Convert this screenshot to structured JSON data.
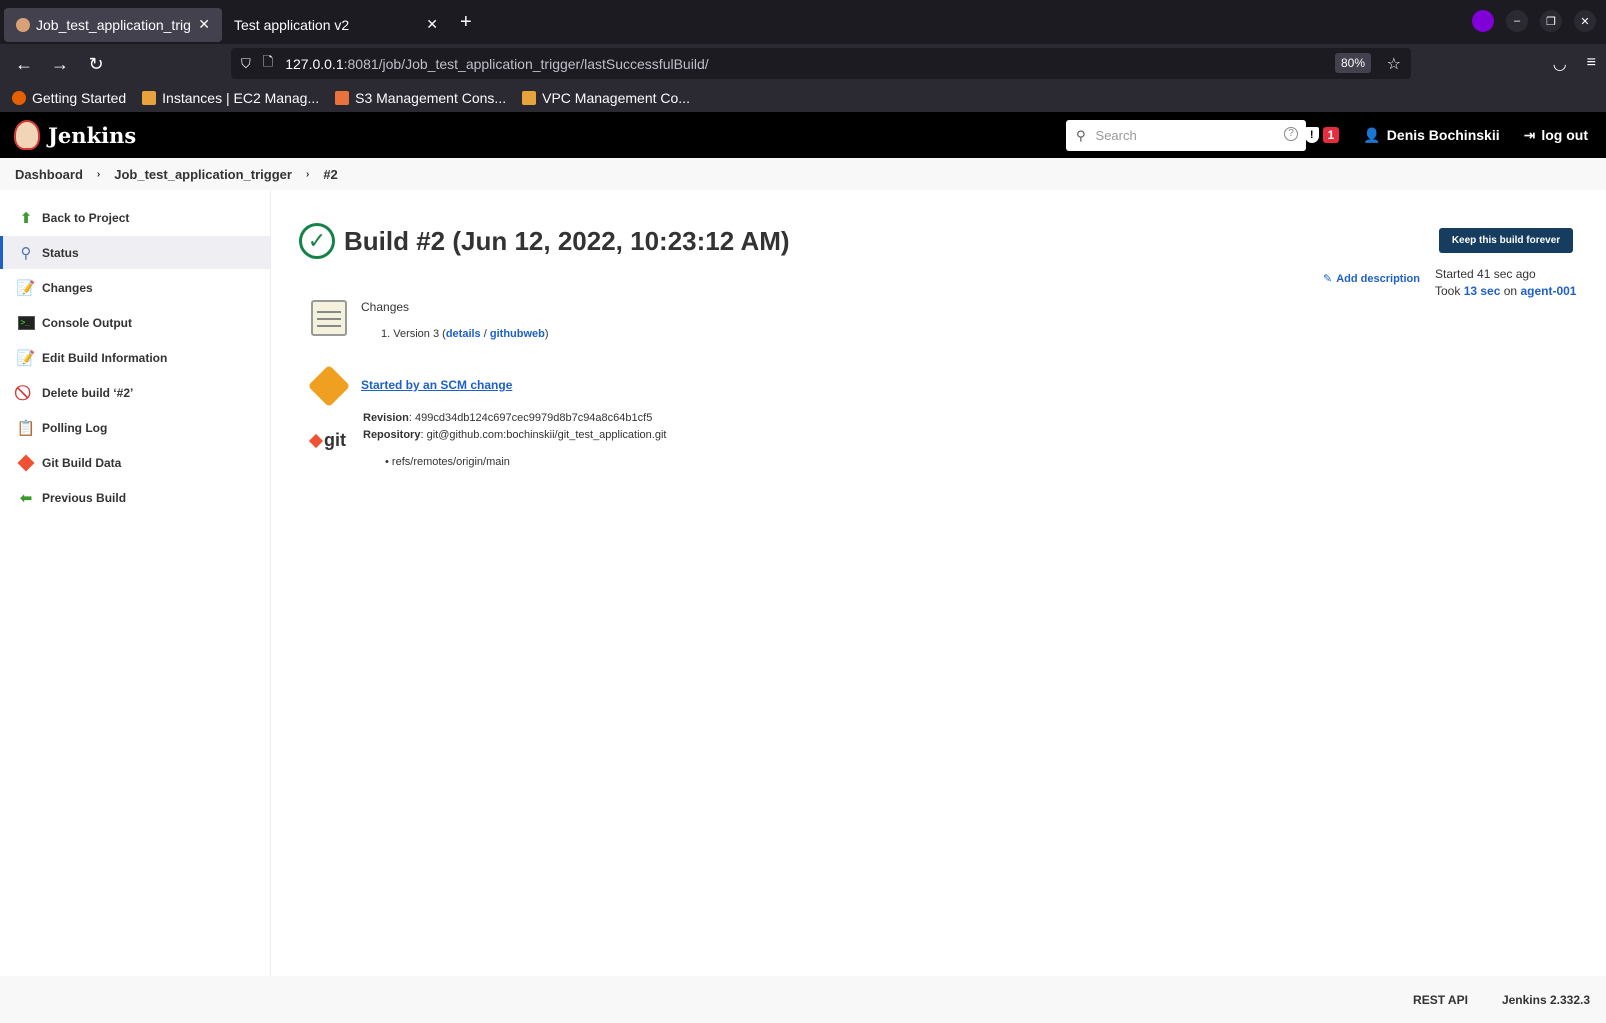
{
  "browser": {
    "tabs": [
      {
        "label": "Job_test_application_trig"
      },
      {
        "label": "Test application v2"
      }
    ],
    "url_host": "127.0.0.1",
    "url_path": ":8081/job/Job_test_application_trigger/lastSuccessfulBuild/",
    "zoom": "80%",
    "bookmarks": [
      {
        "label": "Getting Started"
      },
      {
        "label": "Instances | EC2 Manag..."
      },
      {
        "label": "S3 Management Cons..."
      },
      {
        "label": "VPC Management Co..."
      }
    ]
  },
  "header": {
    "brand": "Jenkins",
    "search_placeholder": "Search",
    "alert_count": "1",
    "user": "Denis Bochinskii",
    "logout": "log out"
  },
  "breadcrumb": [
    "Dashboard",
    "Job_test_application_trigger",
    "#2"
  ],
  "sidebar": {
    "items": [
      {
        "label": "Back to Project",
        "icon": "up-arrow-icon"
      },
      {
        "label": "Status",
        "icon": "magnifier-icon"
      },
      {
        "label": "Changes",
        "icon": "notepad-icon"
      },
      {
        "label": "Console Output",
        "icon": "terminal-icon"
      },
      {
        "label": "Edit Build Information",
        "icon": "notepad-icon"
      },
      {
        "label": "Delete build ‘#2’",
        "icon": "no-entry-icon"
      },
      {
        "label": "Polling Log",
        "icon": "clipboard-icon"
      },
      {
        "label": "Git Build Data",
        "icon": "git-icon"
      },
      {
        "label": "Previous Build",
        "icon": "left-arrow-icon"
      }
    ]
  },
  "main": {
    "title": "Build #2 (Jun 12, 2022, 10:23:12 AM)",
    "keep_button": "Keep this build forever",
    "add_description": "Add description",
    "started": "Started 41 sec ago",
    "took_prefix": "Took",
    "took_time": "13 sec",
    "on": "on",
    "agent": "agent-001",
    "changes_label": "Changes",
    "change_item": {
      "text": "1. Version 3 (",
      "details": "details",
      "slash": "/",
      "githubweb": "githubweb",
      "close": ")"
    },
    "scm_cause": "Started by an SCM change",
    "revision_label": "Revision",
    "revision": "499cd34db124c697cec9979d8b7c94a8c64b1cf5",
    "repository_label": "Repository",
    "repository": "git@github.com:bochinskii/git_test_application.git",
    "branch": "refs/remotes/origin/main"
  },
  "footer": {
    "rest_api": "REST API",
    "version": "Jenkins 2.332.3"
  },
  "colors": {
    "success": "#138347",
    "link": "#1d61c8",
    "keep_button": "#163d5f",
    "badge": "#e52d3d"
  }
}
